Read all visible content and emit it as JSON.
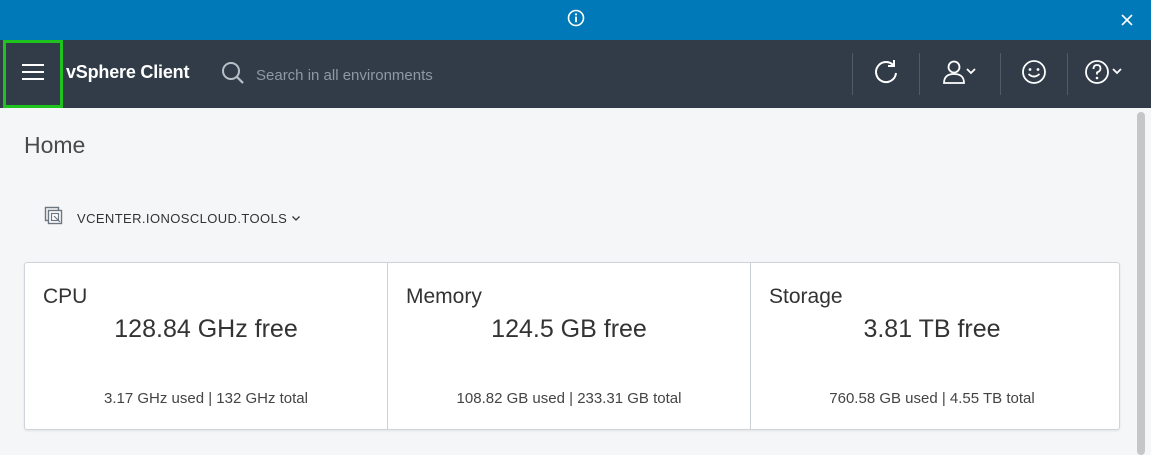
{
  "header": {
    "app_title": "vSphere Client",
    "search_placeholder": "Search in all environments"
  },
  "icons": {
    "banner": "info-icon",
    "close": "close-icon",
    "menu": "hamburger-menu-icon",
    "search": "search-icon",
    "refresh": "refresh-icon",
    "user": "user-icon",
    "feedback": "smiley-icon",
    "help": "help-icon",
    "vcenter": "vcenter-icon"
  },
  "page": {
    "title": "Home",
    "vcenter": "VCENTER.IONOSCLOUD.TOOLS"
  },
  "metrics": [
    {
      "name": "CPU",
      "free": "128.84 GHz free",
      "detail": "3.17 GHz used | 132 GHz total"
    },
    {
      "name": "Memory",
      "free": "124.5 GB free",
      "detail": "108.82 GB used | 233.31 GB total"
    },
    {
      "name": "Storage",
      "free": "3.81 TB free",
      "detail": "760.58 GB used | 4.55 TB total"
    }
  ],
  "colors": {
    "banner": "#0079b8",
    "header": "#313c48",
    "menu_highlight": "#1ec31e"
  }
}
